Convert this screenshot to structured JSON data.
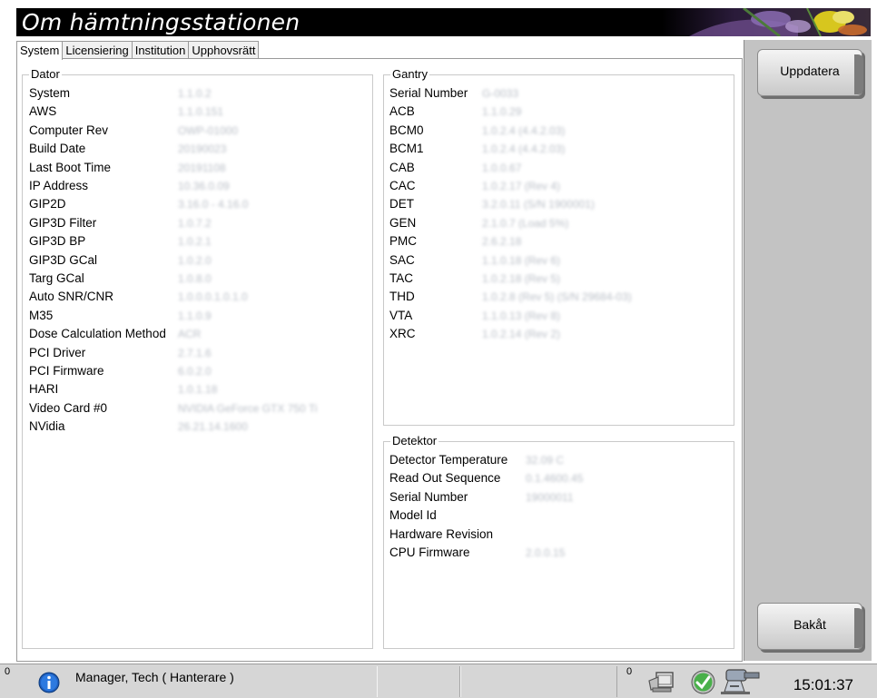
{
  "window": {
    "title": "Om hämtningsstationen"
  },
  "tabs": [
    {
      "label": "System",
      "active": true
    },
    {
      "label": "Licensiering",
      "active": false
    },
    {
      "label": "Institution",
      "active": false
    },
    {
      "label": "Upphovsrätt",
      "active": false
    }
  ],
  "dator": {
    "heading": "Dator",
    "rows": [
      {
        "label": "System",
        "value": "1.1.0.2"
      },
      {
        "label": "AWS",
        "value": "1.1.0.151"
      },
      {
        "label": "Computer Rev",
        "value": "OWP-01000"
      },
      {
        "label": "Build Date",
        "value": "20190023"
      },
      {
        "label": "Last Boot Time",
        "value": "20191108"
      },
      {
        "label": "IP Address",
        "value": "10.36.0.09"
      },
      {
        "label": "GIP2D",
        "value": "3.16.0 - 4.16.0"
      },
      {
        "label": "GIP3D Filter",
        "value": "1.0.7.2"
      },
      {
        "label": "GIP3D BP",
        "value": "1.0.2.1"
      },
      {
        "label": "GIP3D GCal",
        "value": "1.0.2.0"
      },
      {
        "label": "Targ GCal",
        "value": "1.0.8.0"
      },
      {
        "label": "Auto SNR/CNR",
        "value": "1.0.0.0.1.0.1.0"
      },
      {
        "label": "M35",
        "value": "1.1.0.9"
      },
      {
        "label": "Dose Calculation Method",
        "value": "ACR"
      },
      {
        "label": "PCI Driver",
        "value": "2.7.1.6"
      },
      {
        "label": "PCI Firmware",
        "value": "6.0.2.0"
      },
      {
        "label": "HARI",
        "value": "1.0.1.18"
      },
      {
        "label": "Video Card #0",
        "value": "NVIDIA GeForce GTX 750 Ti"
      },
      {
        "label": "NVidia",
        "value": "26.21.14.1600"
      }
    ]
  },
  "gantry": {
    "heading": "Gantry",
    "rows": [
      {
        "label": "Serial Number",
        "value": "G-0033"
      },
      {
        "label": "ACB",
        "value": "1.1.0.29"
      },
      {
        "label": "BCM0",
        "value": "1.0.2.4   (4.4.2.03)"
      },
      {
        "label": "BCM1",
        "value": "1.0.2.4   (4.4.2.03)"
      },
      {
        "label": "CAB",
        "value": "1.0.0.67"
      },
      {
        "label": "CAC",
        "value": "1.0.2.17   (Rev 4)"
      },
      {
        "label": "DET",
        "value": "3.2.0.11   (S/N 1900001)"
      },
      {
        "label": "GEN",
        "value": "2.1.0.7   (Load 5%)"
      },
      {
        "label": "PMC",
        "value": "2.6.2.18"
      },
      {
        "label": "SAC",
        "value": "1.1.0.18   (Rev 6)"
      },
      {
        "label": "TAC",
        "value": "1.0.2.18   (Rev 5)"
      },
      {
        "label": "THD",
        "value": "1.0.2.8   (Rev 5)   (S/N 29684-03)"
      },
      {
        "label": "VTA",
        "value": "1.1.0.13   (Rev 8)"
      },
      {
        "label": "XRC",
        "value": "1.0.2.14   (Rev 2)"
      }
    ]
  },
  "detektor": {
    "heading": "Detektor",
    "rows": [
      {
        "label": "Detector Temperature",
        "value": "32.09 C"
      },
      {
        "label": "Read Out Sequence",
        "value": "0.1.4600.45"
      },
      {
        "label": "Serial Number",
        "value": "19000011"
      },
      {
        "label": "Model Id",
        "value": ""
      },
      {
        "label": "Hardware Revision",
        "value": ""
      },
      {
        "label": "CPU Firmware",
        "value": "2.0.0.15"
      }
    ]
  },
  "buttons": {
    "update": "Uppdatera",
    "back": "Bakåt"
  },
  "statusbar": {
    "alert_count": "0",
    "user": "Manager, Tech ( Hanterare )",
    "queue_count": "0",
    "time": "15:01:37"
  },
  "colors": {
    "title_bg": "#000000",
    "right_panel": "#c3c3c3",
    "status_bar": "#d6d6d6"
  },
  "icons": [
    "info-icon",
    "media-icon",
    "ok-check-icon",
    "tube-icon"
  ]
}
